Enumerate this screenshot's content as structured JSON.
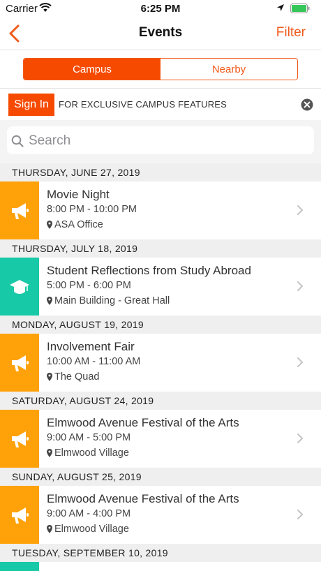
{
  "status_bar": {
    "carrier": "Carrier",
    "time": "6:25 PM"
  },
  "nav": {
    "title": "Events",
    "filter_label": "Filter"
  },
  "segments": [
    {
      "label": "Campus",
      "active": true
    },
    {
      "label": "Nearby",
      "active": false
    }
  ],
  "signin_banner": {
    "button_label": "Sign In",
    "text": "FOR EXCLUSIVE CAMPUS FEATURES"
  },
  "search": {
    "placeholder": "Search"
  },
  "colors": {
    "accent": "#f64a00",
    "event_orange": "#ffa20a",
    "event_teal": "#17c9a6"
  },
  "sections": [
    {
      "date": "THURSDAY, JUNE 27, 2019",
      "events": [
        {
          "title": "Movie Night",
          "time": "8:00 PM - 10:00 PM",
          "location": "ASA Office",
          "icon": "megaphone-icon",
          "color": "#ffa20a"
        }
      ]
    },
    {
      "date": "THURSDAY, JULY 18, 2019",
      "events": [
        {
          "title": "Student Reflections from Study Abroad",
          "time": "5:00 PM - 6:00 PM",
          "location": "Main Building - Great Hall",
          "icon": "graduation-cap-icon",
          "color": "#17c9a6"
        }
      ]
    },
    {
      "date": "MONDAY, AUGUST 19, 2019",
      "events": [
        {
          "title": "Involvement Fair",
          "time": "10:00 AM - 11:00 AM",
          "location": "The Quad",
          "icon": "megaphone-icon",
          "color": "#ffa20a"
        }
      ]
    },
    {
      "date": "SATURDAY, AUGUST 24, 2019",
      "events": [
        {
          "title": "Elmwood Avenue Festival of the Arts",
          "time": "9:00 AM - 5:00 PM",
          "location": "Elmwood Village",
          "icon": "megaphone-icon",
          "color": "#ffa20a"
        }
      ]
    },
    {
      "date": "SUNDAY, AUGUST 25, 2019",
      "events": [
        {
          "title": "Elmwood Avenue Festival of the Arts",
          "time": "9:00 AM - 4:00 PM",
          "location": "Elmwood Village",
          "icon": "megaphone-icon",
          "color": "#ffa20a"
        }
      ]
    },
    {
      "date": "TUESDAY, SEPTEMBER 10, 2019",
      "events": [
        {
          "title": "",
          "time": "",
          "location": "",
          "icon": "",
          "color": "#17c9a6"
        }
      ]
    }
  ]
}
